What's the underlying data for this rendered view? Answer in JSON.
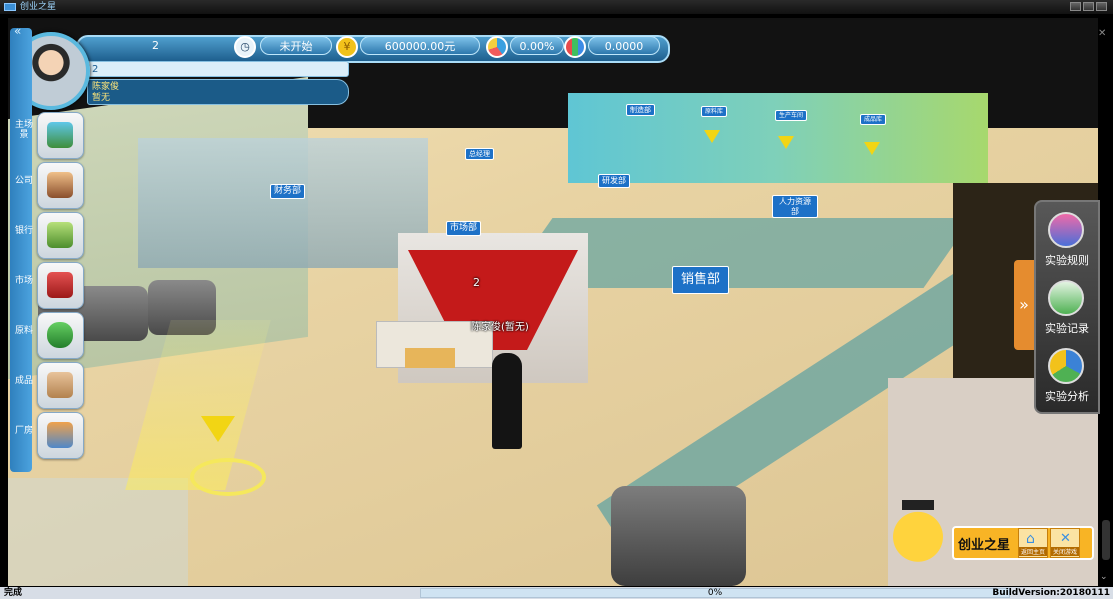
{
  "window": {
    "title": "创业之星"
  },
  "hud": {
    "number": "2",
    "status": "未开始",
    "money": "600000.00元",
    "percent": "0.00%",
    "score": "0.0000",
    "name_field": "2",
    "player_name": "陈家俊",
    "player_role": "暂无"
  },
  "sidebar": {
    "items": [
      {
        "label": "主场景",
        "icon": "main-scene-icon"
      },
      {
        "label": "公司",
        "icon": "company-icon"
      },
      {
        "label": "银行",
        "icon": "bank-icon"
      },
      {
        "label": "市场",
        "icon": "market-icon"
      },
      {
        "label": "原料",
        "icon": "material-icon"
      },
      {
        "label": "成品",
        "icon": "product-icon"
      },
      {
        "label": "厂房",
        "icon": "factory-icon"
      }
    ]
  },
  "scene": {
    "departments": {
      "finance": "财务部",
      "ceo": "总经理",
      "manufacture": "制造部",
      "rd": "研发部",
      "market": "市场部",
      "hr": "人力资源部",
      "sales": "销售部",
      "materials": "原料库",
      "production": "生产车间",
      "finished": "成品库"
    },
    "counter_number": "2",
    "character_label": "陈家俊(暂无)"
  },
  "right_panel": {
    "items": [
      {
        "label": "实验规则"
      },
      {
        "label": "实验记录"
      },
      {
        "label": "实验分析"
      }
    ],
    "toggle": "»"
  },
  "brand": {
    "name": "创业之星",
    "home_label": "返回主页",
    "close_label": "关闭游戏"
  },
  "status": {
    "left": "完成",
    "progress_text": "0%",
    "progress_value": 0,
    "build": "BuildVersion:20180111"
  },
  "colors": {
    "accent_blue": "#1d71c7",
    "hud_blue": "#2d78ad",
    "sales_red": "#c41a1a",
    "brand_orange": "#f8b425"
  }
}
